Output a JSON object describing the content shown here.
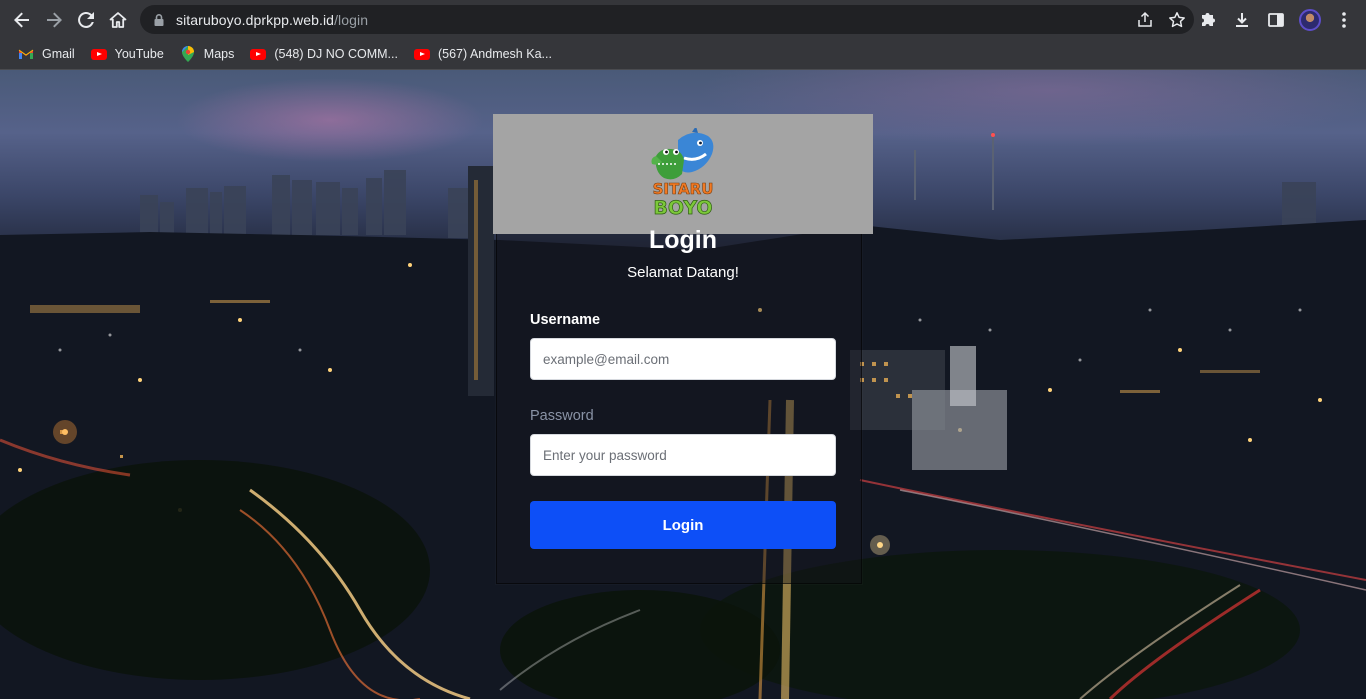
{
  "browser": {
    "url_host": "sitaruboyo.dprkpp.web.id",
    "url_path": "/login"
  },
  "bookmarks": [
    {
      "label": "Gmail",
      "icon": "gmail-icon"
    },
    {
      "label": "YouTube",
      "icon": "youtube-icon"
    },
    {
      "label": "Maps",
      "icon": "maps-icon"
    },
    {
      "label": "(548) DJ NO COMM...",
      "icon": "youtube-icon"
    },
    {
      "label": "(567) Andmesh Ka...",
      "icon": "youtube-icon"
    }
  ],
  "login": {
    "logo_text_top": "SITARU",
    "logo_text_bottom": "BOYO",
    "title": "Login",
    "subtitle": "Selamat Datang!",
    "username_label": "Username",
    "username_placeholder": "example@email.com",
    "password_label": "Password",
    "password_placeholder": "Enter your password",
    "button_label": "Login"
  },
  "colors": {
    "primary_button": "#0d4ff7",
    "logo_header_bg": "#a4a4a4",
    "browser_toolbar": "#35363a"
  }
}
